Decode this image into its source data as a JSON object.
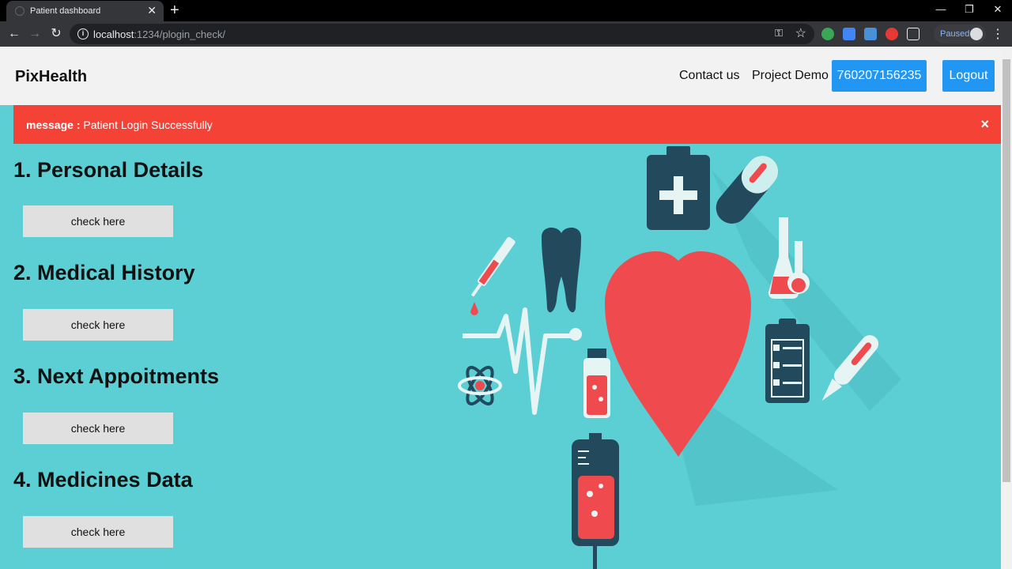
{
  "browser": {
    "tab_title": "Patient dashboard",
    "url_host": "localhost",
    "url_path": ":1234/plogin_check/",
    "profile_status": "Paused"
  },
  "header": {
    "brand": "PixHealth",
    "links": [
      "Contact us",
      "Project Demo"
    ],
    "phone": "760207156235",
    "logout": "Logout"
  },
  "alert": {
    "label": "message :",
    "text": "Patient Login Successfully",
    "close": "×"
  },
  "sections": [
    {
      "title": "1. Personal Details",
      "button": "check here"
    },
    {
      "title": "2. Medical History",
      "button": "check here"
    },
    {
      "title": "3. Next Appoitments",
      "button": "check here"
    },
    {
      "title": "4. Medicines Data",
      "button": "check here"
    }
  ],
  "colors": {
    "page_bg": "#5bcfd4",
    "accent": "#2196f3",
    "alert": "#f44336",
    "illustration_dark": "#22495c",
    "illustration_red": "#ef4b4f"
  }
}
